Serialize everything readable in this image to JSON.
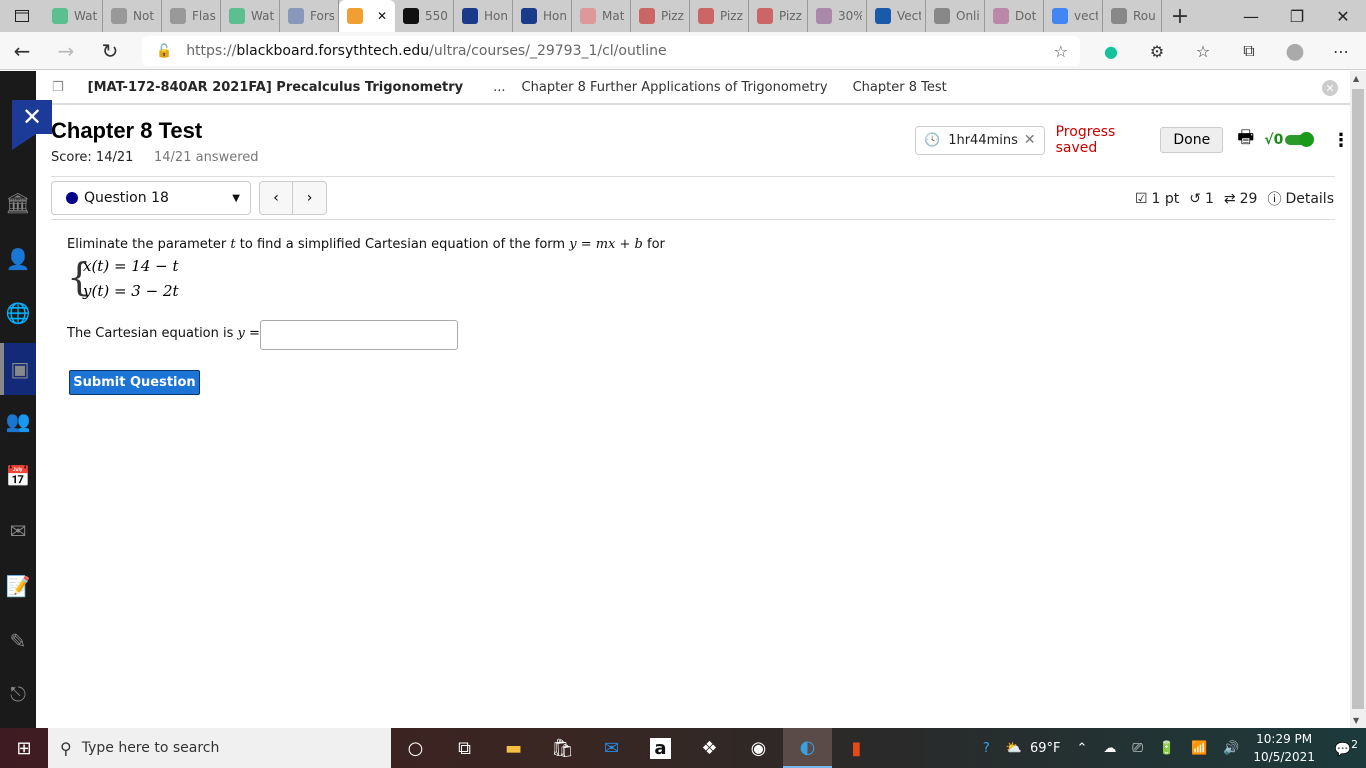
{
  "browser": {
    "tabs": [
      {
        "title": "Wat",
        "icon": "tv-icon",
        "color": "#5bbf8f"
      },
      {
        "title": "Not",
        "icon": "notion-dots-icon",
        "color": "#999"
      },
      {
        "title": "Flas",
        "icon": "page-icon",
        "color": "#999"
      },
      {
        "title": "Wat",
        "icon": "tv-icon",
        "color": "#5bbf8f"
      },
      {
        "title": "Fors",
        "icon": "shield-icon",
        "color": "#8899bb"
      },
      {
        "title": "",
        "icon": "pencil-icon",
        "color": "#f0a030",
        "active": true
      },
      {
        "title": "550",
        "icon": "bb-icon",
        "color": "#111"
      },
      {
        "title": "Hon",
        "icon": "star-shield-icon",
        "color": "#1a3a8a"
      },
      {
        "title": "Hon",
        "icon": "star-shield-icon",
        "color": "#1a3a8a"
      },
      {
        "title": "Mat",
        "icon": "m-icon",
        "color": "#d99"
      },
      {
        "title": "Pizz",
        "icon": "pizza-icon",
        "color": "#c66"
      },
      {
        "title": "Pizz",
        "icon": "pizza-icon",
        "color": "#c66"
      },
      {
        "title": "Pizz",
        "icon": "pizza-icon",
        "color": "#c66"
      },
      {
        "title": "30%",
        "icon": "r-icon",
        "color": "#a8a"
      },
      {
        "title": "Vect",
        "icon": "dot-icon",
        "color": "#1a5aaa"
      },
      {
        "title": "Onli",
        "icon": "root-icon",
        "color": "#888"
      },
      {
        "title": "Dot",
        "icon": "b-icon",
        "color": "#b8a"
      },
      {
        "title": "vect",
        "icon": "google-icon",
        "color": "#4285f4"
      },
      {
        "title": "Rou",
        "icon": "sigma-icon",
        "color": "#888"
      }
    ],
    "url_prefix": "https://",
    "url_host": "blackboard.forsythtech.edu",
    "url_path": "/ultra/courses/_29793_1/cl/outline"
  },
  "breadcrumb": {
    "course": "[MAT-172-840AR 2021FA] Precalculus Trigonometry",
    "ellipsis": "...",
    "chapter": "Chapter 8 Further Applications of Trigonometry",
    "current": "Chapter 8 Test"
  },
  "test": {
    "title": "Chapter 8 Test",
    "score": "Score: 14/21",
    "answered": "14/21 answered",
    "timer": "1hr44mins",
    "progress": "Progress saved",
    "done": "Done",
    "math_toggle": "√0"
  },
  "question": {
    "selector": "Question 18",
    "points": "1 pt",
    "retries": "1",
    "attempts": "29",
    "details": "Details",
    "prompt_before": "Eliminate the parameter ",
    "prompt_t": "t",
    "prompt_mid": " to find a simplified Cartesian equation of the form ",
    "prompt_form": "y = mx + b",
    "prompt_after": " for",
    "eq1": "x(t) = 14 − t",
    "eq2": "y(t) = 3 − 2t",
    "answer_label": "The Cartesian equation is ",
    "answer_var": "y",
    "answer_eq": " =",
    "answer_value": "",
    "submit": "Submit Question"
  },
  "taskbar": {
    "search_placeholder": "Type here to search",
    "weather": "69°F",
    "time": "10:29 PM",
    "date": "10/5/2021",
    "notifications": "2"
  }
}
